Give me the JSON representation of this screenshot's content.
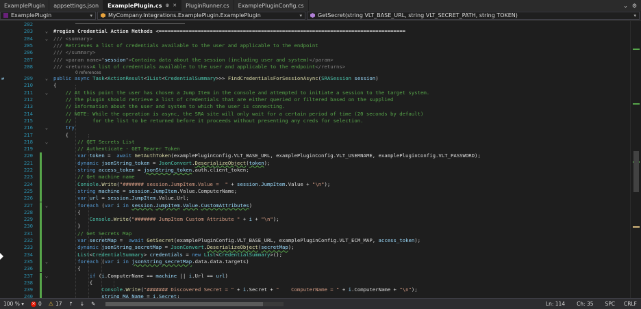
{
  "tabs": [
    {
      "label": "ExamplePlugin",
      "active": false
    },
    {
      "label": "appsettings.json",
      "active": false
    },
    {
      "label": "ExamplePlugin.cs",
      "active": true
    },
    {
      "label": "PluginRunner.cs",
      "active": false
    },
    {
      "label": "ExamplePluginConfig.cs",
      "active": false
    }
  ],
  "tab_icons": {
    "pin": "pin-icon",
    "close": "close-icon",
    "settings": "gear-icon",
    "dropdown": "chevron-down-icon"
  },
  "navbar": {
    "project": "ExamplePlugin",
    "class": "MyCompany.Integrations.ExamplePlugin.ExamplePlugin",
    "member": "GetSecret(string VLT_BASE_URL, string VLT_SECRET_PATH, string TOKEN)"
  },
  "editor": {
    "references_label": "0 references",
    "lines": [
      {
        "n": "202",
        "html": ""
      },
      {
        "n": "203",
        "html": "<span class='reg'>#region Credential Action Methods &lt;==================================================================================</span>",
        "fold": "⌄"
      },
      {
        "n": "204",
        "html": "<span class='x'>///</span><span class='c'> </span><span class='x'>&lt;summary&gt;</span>",
        "fold": "⌄"
      },
      {
        "n": "205",
        "html": "<span class='x'>///</span><span class='c'> Retrieves a list of credentials available to the user and applicable to the endpoint</span>"
      },
      {
        "n": "206",
        "html": "<span class='x'>///</span><span class='c'> </span><span class='x'>&lt;/summary&gt;</span>"
      },
      {
        "n": "207",
        "html": "<span class='x'>///</span><span class='c'> </span><span class='x'>&lt;param name=\"</span><span class='v'>session</span><span class='x'>\"&gt;</span><span class='c'>Contains data about the session (including user and system)</span><span class='x'>&lt;/param&gt;</span>"
      },
      {
        "n": "208",
        "html": "<span class='x'>///</span><span class='c'> </span><span class='x'>&lt;returns&gt;</span><span class='c'>A list of credentials available to the user and applicable to the endpoint</span><span class='x'>&lt;/returns&gt;</span>"
      },
      {
        "n": "209",
        "html": "<span class='k'>public async </span><span class='t'>Task</span>&lt;<span class='t'>ActionResult</span>&lt;<span class='t'>IList</span>&lt;<span class='t'>CredentialSummary</span>&gt;&gt;&gt; <span class='m'>FindCredentialsForSessionAsync</span>(<span class='t'>SRASession</span> <span class='v'>session</span>)",
        "fold": "⌄",
        "bookmark": true
      },
      {
        "n": "210",
        "html": "{"
      },
      {
        "n": "211",
        "html": "    <span class='c'>// At this point the user has chosen a Jump Item in the console and attempted to initiate a session to the target system.</span>",
        "fold": "⌄"
      },
      {
        "n": "212",
        "html": "    <span class='c'>// The plugin should retrieve a list of credentials that are either queried or filtered based on the supplied</span>"
      },
      {
        "n": "213",
        "html": "    <span class='c'>// information about the user and system to which the user is connecting.</span>"
      },
      {
        "n": "214",
        "html": "    <span class='c'>// NOTE: While the operation is async, the SRA site will only wait for a certain period of time (20 seconds by default)</span>"
      },
      {
        "n": "215",
        "html": "    <span class='c'>//       for the list to be returned before it proceeds without presenting any creds for selection.</span>"
      },
      {
        "n": "216",
        "html": "    <span class='k'>try</span>",
        "fold": "⌄"
      },
      {
        "n": "217",
        "html": "    {"
      },
      {
        "n": "218",
        "html": "        <span class='c'>// GET Secrets List</span>",
        "fold": "⌄"
      },
      {
        "n": "219",
        "html": "        <span class='c'>// Authenticate - GET Bearer Token</span>"
      },
      {
        "n": "220",
        "html": "        <span class='k'>var</span> <span class='v'>token</span> =  <span class='k'>await</span> <span class='m'>GetAuthToken</span>(examplePluginConfig.VLT_BASE_URL, examplePluginConfig.VLT_USERNAME, examplePluginConfig.VLT_PASSWORD);",
        "chg": true
      },
      {
        "n": "221",
        "html": "        <span class='k'>dynamic</span> <span class='v'>jsonString_token</span> = <span class='t'>JsonConvert</span>.<span class='m sq'>DeserializeObject</span>(<span class='v sq'>token</span>);",
        "chg": true
      },
      {
        "n": "222",
        "html": "        <span class='k'>string</span> <span class='v'>access_token</span> = <span class='v sq'>jsonString_token</span>.auth.client_token;",
        "chg": true
      },
      {
        "n": "223",
        "html": "        <span class='c'>// Get machine name</span>",
        "chg": true
      },
      {
        "n": "224",
        "html": "        <span class='t'>Console</span>.<span class='m'>Write</span>(<span class='s'>\"####### session.JumpItem.Value =  \"</span> + <span class='v'>session</span>.<span class='v'>JumpItem</span>.Value + <span class='s'>\"\\n\"</span>);",
        "chg": true
      },
      {
        "n": "225",
        "html": "        <span class='k'>string</span> <span class='v'>machine</span> = <span class='v'>session</span>.<span class='v'>JumpItem</span>.Value.ComputerName;",
        "chg": true
      },
      {
        "n": "226",
        "html": "        <span class='k'>var</span> <span class='v'>url</span> = <span class='v'>session</span>.<span class='v'>JumpItem</span>.Value.Url;",
        "chg": true
      },
      {
        "n": "227",
        "html": "        <span class='k'>foreach</span> (<span class='k'>var</span> <span class='v'>i</span> <span class='k'>in</span> <span class='v sq'>session</span>.<span class='v sq'>JumpItem</span>.<span class='v sq'>Value</span>.<span class='v sq'>CustomAttributes</span>)",
        "chg": true,
        "fold": "⌄"
      },
      {
        "n": "228",
        "html": "        {",
        "chg": true
      },
      {
        "n": "229",
        "html": "            <span class='t'>Console</span>.<span class='m'>Write</span>(<span class='s'>\"####### JumpItem Custom Attribute \"</span> + <span class='v'>i</span> + <span class='s'>\"\\n\"</span>);",
        "chg": true
      },
      {
        "n": "230",
        "html": "        }",
        "chg": true
      },
      {
        "n": "231",
        "html": "        <span class='c'>// Get Secrets Map</span>",
        "chg": true
      },
      {
        "n": "232",
        "html": "        <span class='k'>var</span> <span class='v'>secretMap</span> =  <span class='k'>await</span> <span class='m'>GetSecret</span>(examplePluginConfig.VLT_BASE_URL, examplePluginConfig.VLT_ECM_MAP, <span class='v'>access_token</span>);",
        "chg": true
      },
      {
        "n": "233",
        "html": "        <span class='k'>dynamic</span> <span class='v'>jsonString_secretMap</span> = <span class='t'>JsonConvert</span>.<span class='m sq'>DeserializeObject</span>(<span class='v sq'>secretMap</span>);",
        "chg": true
      },
      {
        "n": "234",
        "html": "        <span class='t'>List</span>&lt;<span class='t'>CredentialSummary</span>&gt; <span class='v'>credentials</span> = <span class='k'>new</span> <span class='t'>List</span>&lt;<span class='t'>CredentialSummary</span>&gt;();",
        "chg": true
      },
      {
        "n": "235",
        "html": "        <span class='k'>foreach</span> (<span class='k'>var</span> <span class='v'>i</span> <span class='k'>in</span> <span class='v sq'>jsonString_secretMap</span>.data.data.targets)",
        "chg": true,
        "fold": "⌄"
      },
      {
        "n": "236",
        "html": "        {",
        "chg": true
      },
      {
        "n": "237",
        "html": "            <span class='k'>if</span> (<span class='v'>i</span>.ComputerName == <span class='v'>machine</span> || <span class='v'>i</span>.Url == <span class='v'>url</span>)",
        "chg": true,
        "fold": "⌄"
      },
      {
        "n": "238",
        "html": "            {",
        "chg": true
      },
      {
        "n": "239",
        "html": "                <span class='t'>Console</span>.<span class='m'>Write</span>(<span class='s'>\"####### Discovered Secret = \"</span> + <span class='v'>i</span>.Secret + <span class='s'>\"    ComputerName = \"</span> + <span class='v'>i</span>.ComputerName + <span class='s'>\"\\n\"</span>);",
        "chg": true
      },
      {
        "n": "240",
        "html": "                <span class='v'>string</span> <span class='v'>MA_Name</span> = <span class='v'>i</span>.<span class='v'>Secret</span>;",
        "chg": true
      }
    ]
  },
  "status": {
    "zoom": "100 %",
    "errors": "0",
    "warnings": "17",
    "line": "Ln: 114",
    "col": "Ch: 35",
    "whitespace": "SPC",
    "eol": "CRLF"
  }
}
